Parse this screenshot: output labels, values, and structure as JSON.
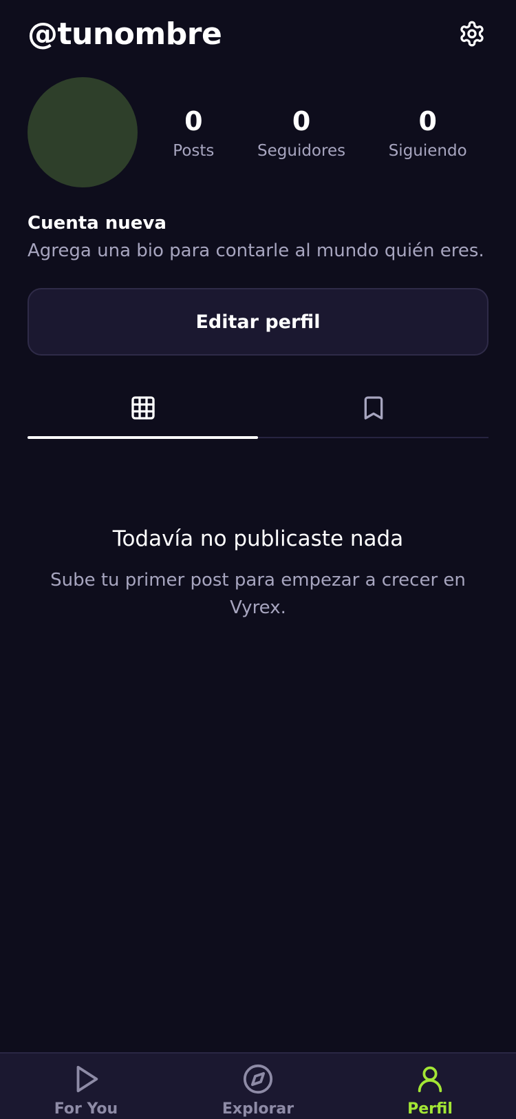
{
  "header": {
    "username": "@tunombre"
  },
  "stats": [
    {
      "value": "0",
      "label": "Posts"
    },
    {
      "value": "0",
      "label": "Seguidores"
    },
    {
      "value": "0",
      "label": "Siguiendo"
    }
  ],
  "profile": {
    "display_name": "Cuenta nueva",
    "bio": "Agrega una bio para contarle al mundo quién eres.",
    "avatar_color": "#2e3f2a"
  },
  "actions": {
    "edit_profile": "Editar perfil"
  },
  "tabs": [
    {
      "icon": "grid-icon",
      "active": true
    },
    {
      "icon": "bookmark-icon",
      "active": false
    }
  ],
  "empty_state": {
    "title": "Todavía no publicaste nada",
    "subtitle": "Sube tu primer post para empezar a crecer en Vyrex."
  },
  "nav": [
    {
      "label": "For You",
      "icon": "play-icon",
      "active": false
    },
    {
      "label": "Explorar",
      "icon": "compass-icon",
      "active": false
    },
    {
      "label": "Perfil",
      "icon": "user-icon",
      "active": true
    }
  ],
  "colors": {
    "background": "#0e0d1c",
    "surface": "#1b1830",
    "accent": "#a3e635",
    "muted_text": "#a7a5bf"
  }
}
